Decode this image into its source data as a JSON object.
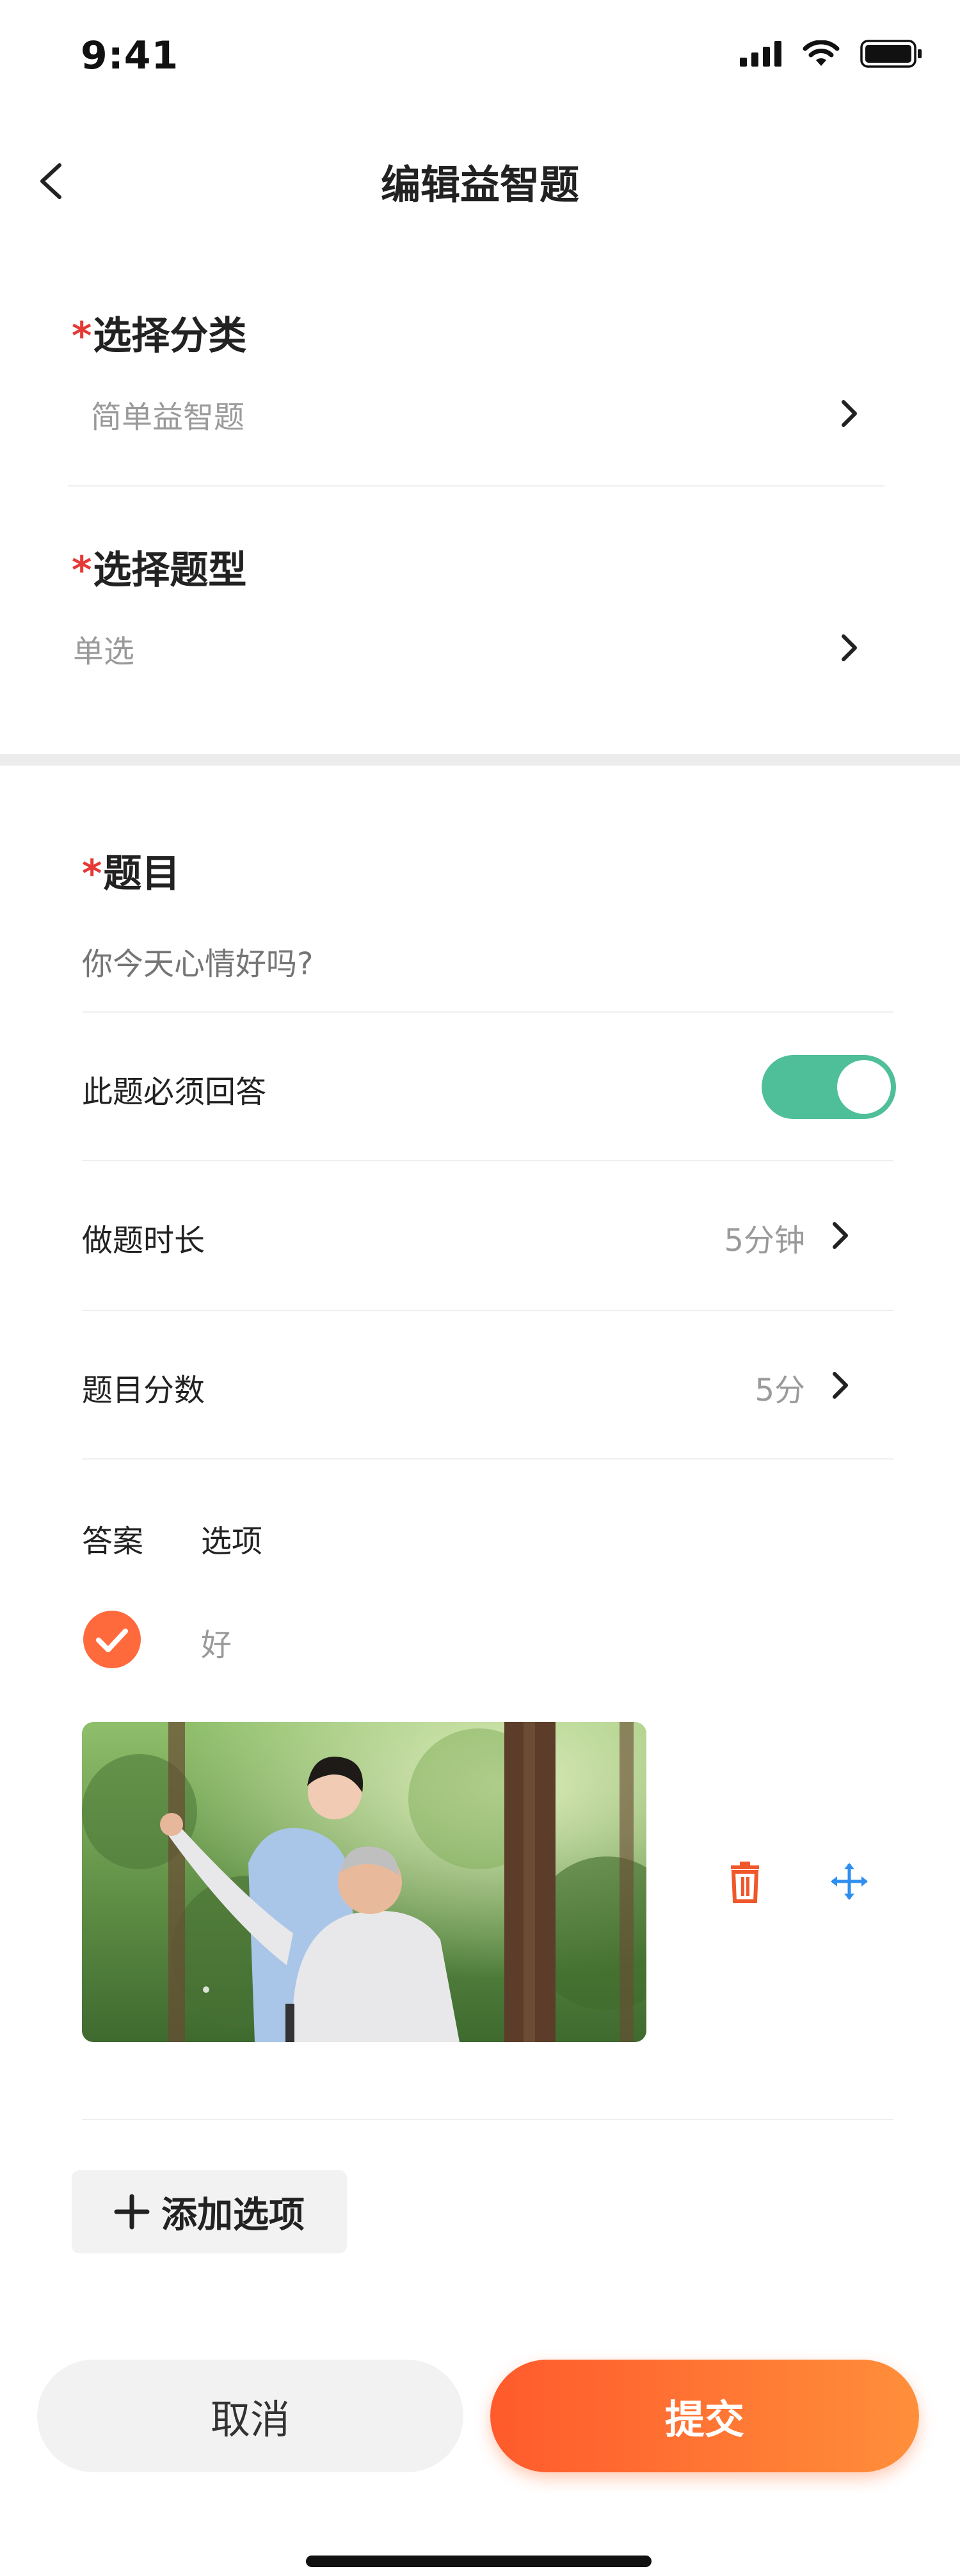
{
  "status_bar": {
    "time": "9:41"
  },
  "header": {
    "title": "编辑益智题"
  },
  "category": {
    "label": "选择分类",
    "required_mark": "*",
    "value": "简单益智题"
  },
  "question_type": {
    "label": "选择题型",
    "required_mark": "*",
    "value": "单选"
  },
  "question": {
    "label": "题目",
    "required_mark": "*",
    "placeholder": "你今天心情好吗?"
  },
  "required_answer": {
    "label": "此题必须回答",
    "enabled": true
  },
  "duration": {
    "label": "做题时长",
    "value": "5分钟"
  },
  "score": {
    "label": "题目分数",
    "value": "5分"
  },
  "options_header": {
    "answer": "答案",
    "option": "选项"
  },
  "options": [
    {
      "text": "好",
      "correct": true
    }
  ],
  "add_option": {
    "label": "添加选项"
  },
  "footer": {
    "cancel": "取消",
    "submit": "提交"
  },
  "colors": {
    "accent": "#ff6a3d",
    "toggle": "#4fbf99",
    "move": "#2f8ff0",
    "required": "#e53935"
  }
}
